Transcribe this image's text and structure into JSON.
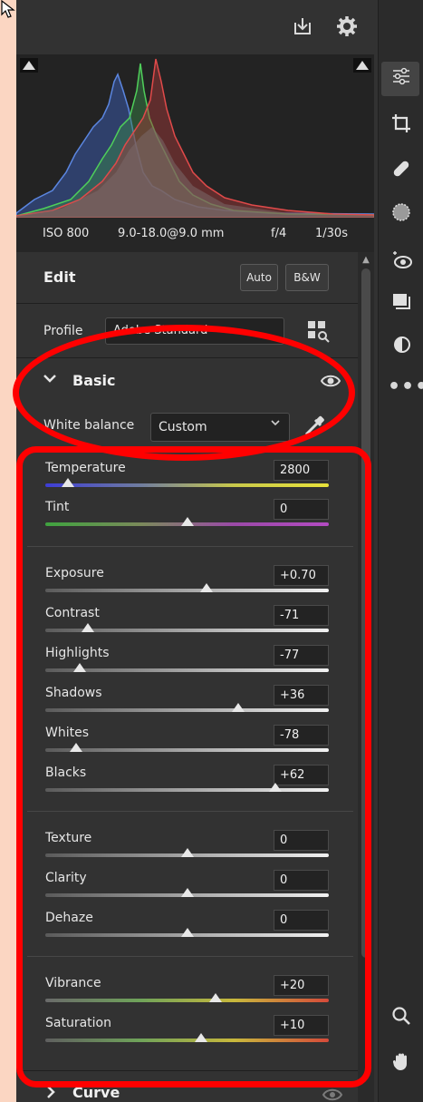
{
  "colors": {
    "panel": "#323232",
    "histogram_bg": "#232323",
    "annotation_red": "#ff0000",
    "page_bg": "#fbd6c2"
  },
  "topbar": {
    "icons": [
      "save-icon",
      "gear-icon",
      "expand-icon"
    ]
  },
  "toolstrip": {
    "icons": [
      "edit-sliders-icon",
      "crop-icon",
      "healing-icon",
      "mask-icon",
      "red-eye-icon",
      "presets-icon",
      "snapshots-icon",
      "more-icon",
      "zoom-icon",
      "hand-icon"
    ]
  },
  "metadata": {
    "iso": "ISO 800",
    "lens": "9.0-18.0@9.0 mm",
    "aperture": "f/4",
    "shutter": "1/30s"
  },
  "edit": {
    "title": "Edit",
    "auto_label": "Auto",
    "bw_label": "B&W",
    "profile_label": "Profile",
    "profile_value": "Adobe Standard"
  },
  "basic": {
    "title": "Basic",
    "wb_label": "White balance",
    "wb_value": "Custom",
    "sliders": [
      {
        "label": "Temperature",
        "value": "2800",
        "position": 0.08
      },
      {
        "label": "Tint",
        "value": "0",
        "position": 0.5
      },
      {
        "label": "Exposure",
        "value": "+0.70",
        "position": 0.57
      },
      {
        "label": "Contrast",
        "value": "-71",
        "position": 0.15
      },
      {
        "label": "Highlights",
        "value": "-77",
        "position": 0.12
      },
      {
        "label": "Shadows",
        "value": "+36",
        "position": 0.68
      },
      {
        "label": "Whites",
        "value": "-78",
        "position": 0.11
      },
      {
        "label": "Blacks",
        "value": "+62",
        "position": 0.81
      },
      {
        "label": "Texture",
        "value": "0",
        "position": 0.5
      },
      {
        "label": "Clarity",
        "value": "0",
        "position": 0.5
      },
      {
        "label": "Dehaze",
        "value": "0",
        "position": 0.5
      },
      {
        "label": "Vibrance",
        "value": "+20",
        "position": 0.6
      },
      {
        "label": "Saturation",
        "value": "+10",
        "position": 0.55
      }
    ]
  },
  "curve": {
    "title": "Curve"
  }
}
